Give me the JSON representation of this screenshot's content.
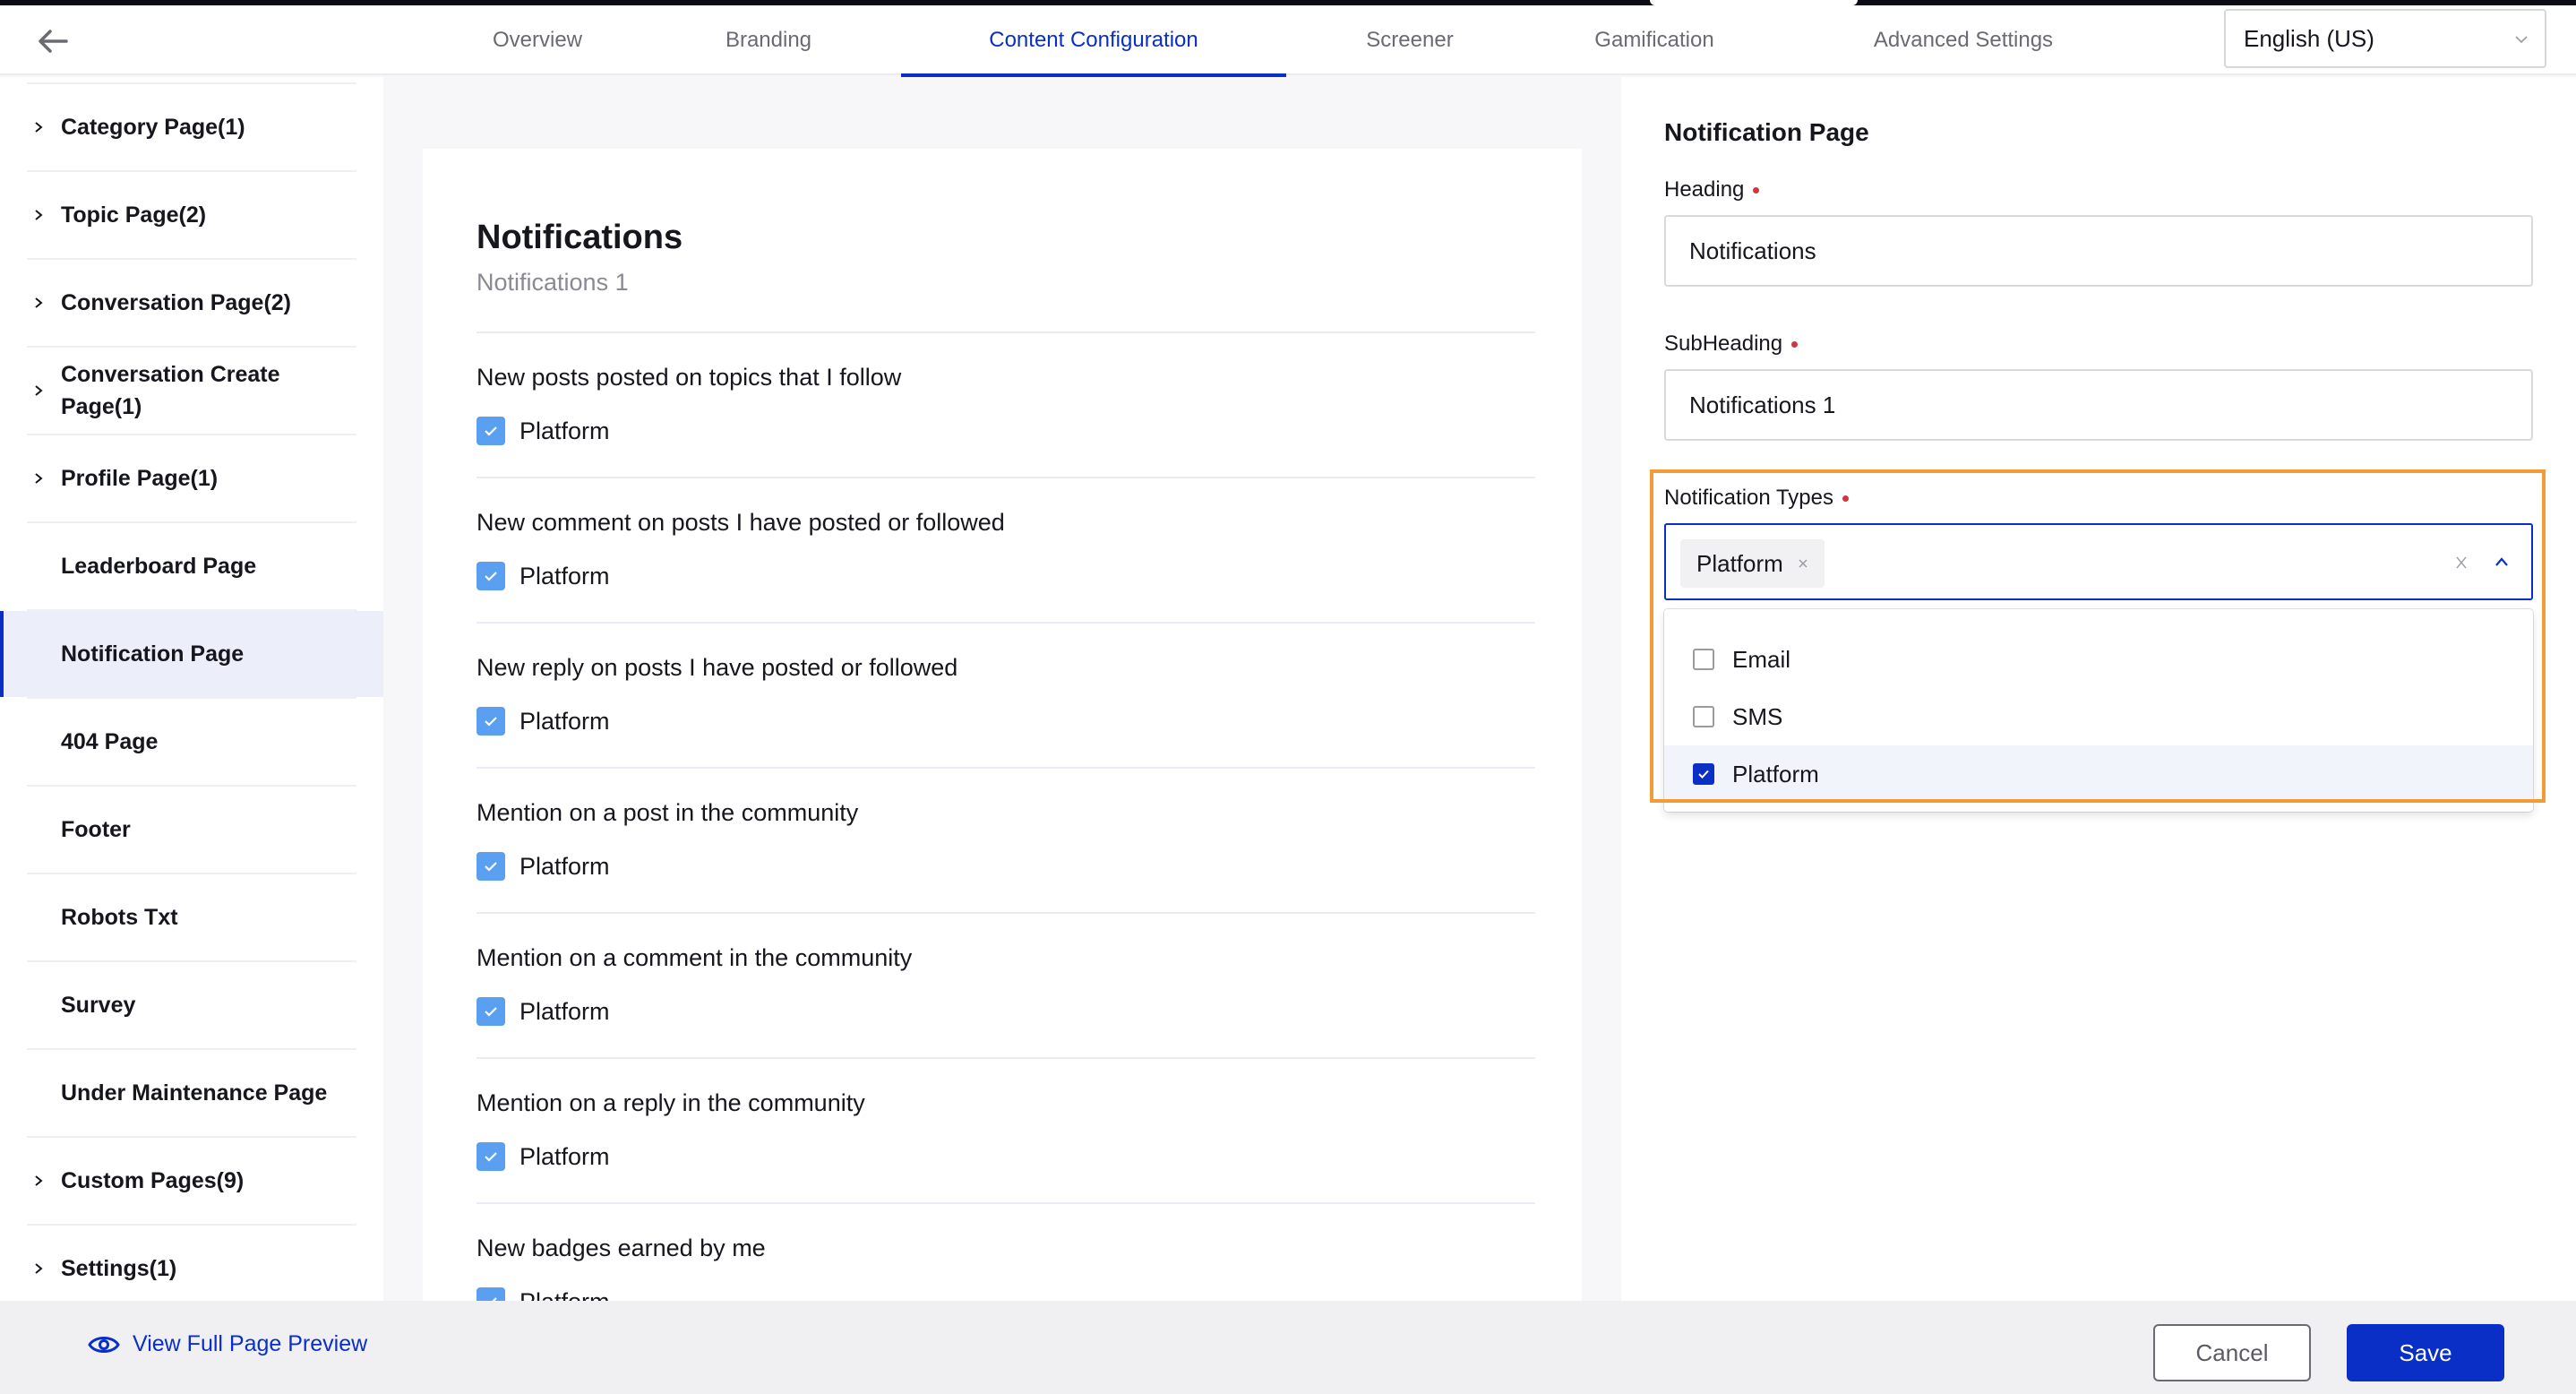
{
  "header": {
    "back_icon": "arrow-left-icon",
    "tabs": [
      {
        "label": "Overview",
        "active": false
      },
      {
        "label": "Branding",
        "active": false
      },
      {
        "label": "Content Configuration",
        "active": true
      },
      {
        "label": "Screener",
        "active": false
      },
      {
        "label": "Gamification",
        "active": false
      },
      {
        "label": "Advanced Settings",
        "active": false
      }
    ],
    "language": {
      "value": "English (US)",
      "icon": "chevron-down-icon"
    }
  },
  "sidebar": {
    "items": [
      {
        "label": "Category Page(1)",
        "expandable": true,
        "active": false
      },
      {
        "label": "Topic Page(2)",
        "expandable": true,
        "active": false
      },
      {
        "label": "Conversation Page(2)",
        "expandable": true,
        "active": false
      },
      {
        "label": "Conversation Create Page(1)",
        "expandable": true,
        "active": false
      },
      {
        "label": "Profile Page(1)",
        "expandable": true,
        "active": false
      },
      {
        "label": "Leaderboard Page",
        "expandable": false,
        "active": false
      },
      {
        "label": "Notification Page",
        "expandable": false,
        "active": true
      },
      {
        "label": "404 Page",
        "expandable": false,
        "active": false
      },
      {
        "label": "Footer",
        "expandable": false,
        "active": false
      },
      {
        "label": "Robots Txt",
        "expandable": false,
        "active": false
      },
      {
        "label": "Survey",
        "expandable": false,
        "active": false
      },
      {
        "label": "Under Maintenance Page",
        "expandable": false,
        "active": false
      },
      {
        "label": "Custom Pages(9)",
        "expandable": true,
        "active": false
      },
      {
        "label": "Settings(1)",
        "expandable": true,
        "active": false
      }
    ]
  },
  "preview": {
    "title": "Notifications",
    "subtitle": "Notifications 1",
    "notifications": [
      {
        "title": "New posts posted on topics that I follow",
        "option": "Platform",
        "checked": true
      },
      {
        "title": "New comment on posts I have posted or followed",
        "option": "Platform",
        "checked": true
      },
      {
        "title": "New reply on posts I have posted or followed",
        "option": "Platform",
        "checked": true
      },
      {
        "title": "Mention on a post in the community",
        "option": "Platform",
        "checked": true
      },
      {
        "title": "Mention on a comment in the community",
        "option": "Platform",
        "checked": true
      },
      {
        "title": "Mention on a reply in the community",
        "option": "Platform",
        "checked": true
      },
      {
        "title": "New badges earned by me",
        "option": "Platform",
        "checked": true
      }
    ]
  },
  "settings_panel": {
    "title": "Notification Page",
    "heading": {
      "label": "Heading",
      "required": true,
      "value": "Notifications"
    },
    "subheading": {
      "label": "SubHeading",
      "required": true,
      "value": "Notifications 1"
    },
    "notification_types": {
      "label": "Notification Types",
      "required": true,
      "selected_chips": [
        "Platform"
      ],
      "dropdown_open": true,
      "options": [
        {
          "label": "Email",
          "checked": false
        },
        {
          "label": "SMS",
          "checked": false
        },
        {
          "label": "Platform",
          "checked": true
        }
      ]
    }
  },
  "footer": {
    "preview_link": "View Full Page Preview",
    "preview_icon": "eye-icon",
    "cancel_label": "Cancel",
    "save_label": "Save"
  },
  "colors": {
    "accent": "#0a2fc7",
    "preview_checkbox": "#5b9ff0",
    "required_dot": "#d0363e",
    "highlight_outline": "#f39c36",
    "active_sidebar_bg": "#eceff9"
  }
}
